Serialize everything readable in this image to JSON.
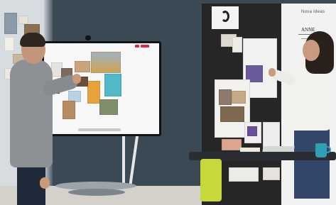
{
  "scene": {
    "colors": {
      "back_wall": "#3b4954",
      "left_wall": "#d8dde2",
      "pinboard": "#262626",
      "whiteboard": "#f2f2f2",
      "floor": "#d4d0ca",
      "teal_mug": "#2e9fb4",
      "lime_chair": "#c8d83a",
      "screen_frame": "#111417"
    },
    "icons": {
      "logo_card": "swirl-logo-icon",
      "camera": "webcam-icon"
    },
    "whiteboard_text": "ANNE",
    "whiteboard_header": "Nova Ideas"
  }
}
